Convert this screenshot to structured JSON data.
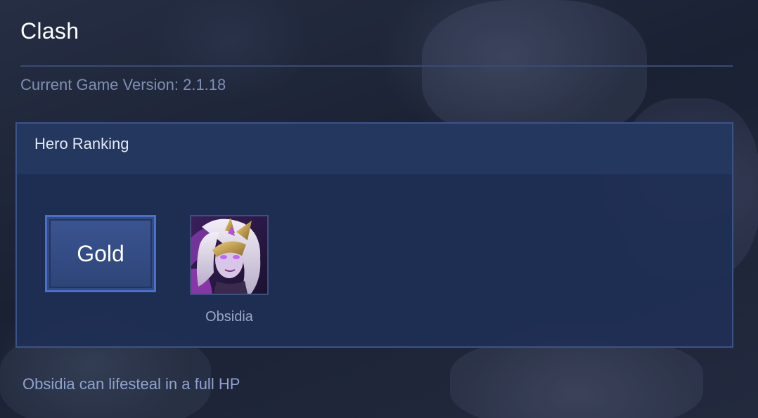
{
  "header": {
    "title": "Clash",
    "version_text": "Current Game Version: 2.1.18"
  },
  "ranking_panel": {
    "title": "Hero Ranking",
    "tiers": [
      {
        "label": "Gold",
        "heroes": [
          {
            "name": "Obsidia"
          }
        ]
      }
    ]
  },
  "footer": {
    "tip": "Obsidia can lifesteal in a full HP"
  },
  "colors": {
    "background": "#1b2235",
    "panel": "#1f2f54",
    "panel_border": "#3c5387",
    "tier_border": "#4a70c7",
    "muted_text": "#7e8fb5"
  }
}
